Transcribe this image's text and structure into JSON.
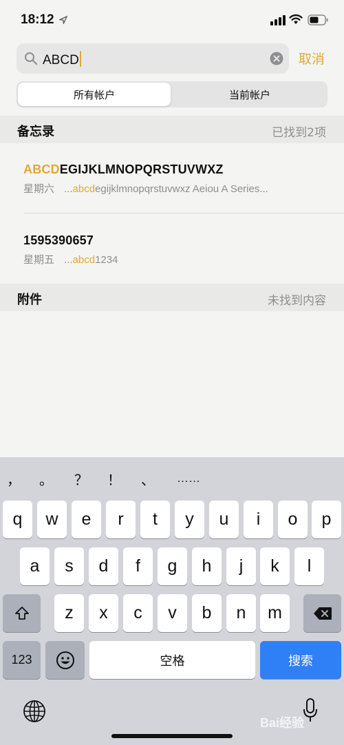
{
  "status_bar": {
    "time": "18:12"
  },
  "search": {
    "query": "ABCD",
    "cancel_label": "取消"
  },
  "segments": {
    "all_accounts": "所有帐户",
    "current_account": "当前帐户"
  },
  "notes_section": {
    "title": "备忘录",
    "count": "已找到2项",
    "results": [
      {
        "title_highlight": "ABCD",
        "title_rest": "EGIJKLMNOPQRSTUVWXZ",
        "date": "星期六",
        "snippet_prefix": "...",
        "snippet_highlight": "abcd",
        "snippet_rest": "egijklmnopqrstuvwxz Aeiou A Series..."
      },
      {
        "title": "1595390657",
        "date": "星期五",
        "snippet_prefix": "...",
        "snippet_highlight": "abcd",
        "snippet_rest": "1234"
      }
    ]
  },
  "attachments_section": {
    "title": "附件",
    "status": "未找到内容"
  },
  "keyboard": {
    "suggestions": [
      "，",
      "。",
      "？",
      "！",
      "、",
      "……"
    ],
    "row1": [
      "q",
      "w",
      "e",
      "r",
      "t",
      "y",
      "u",
      "i",
      "o",
      "p"
    ],
    "row2": [
      "a",
      "s",
      "d",
      "f",
      "g",
      "h",
      "j",
      "k",
      "l"
    ],
    "row3": [
      "z",
      "x",
      "c",
      "v",
      "b",
      "n",
      "m"
    ],
    "numbers_label": "123",
    "space_label": "空格",
    "search_label": "搜索"
  },
  "watermark": "Bai经验",
  "colors": {
    "accent": "#e3a932",
    "keyboard_bg": "#d3d4d9",
    "search_key": "#2f7ff7"
  }
}
